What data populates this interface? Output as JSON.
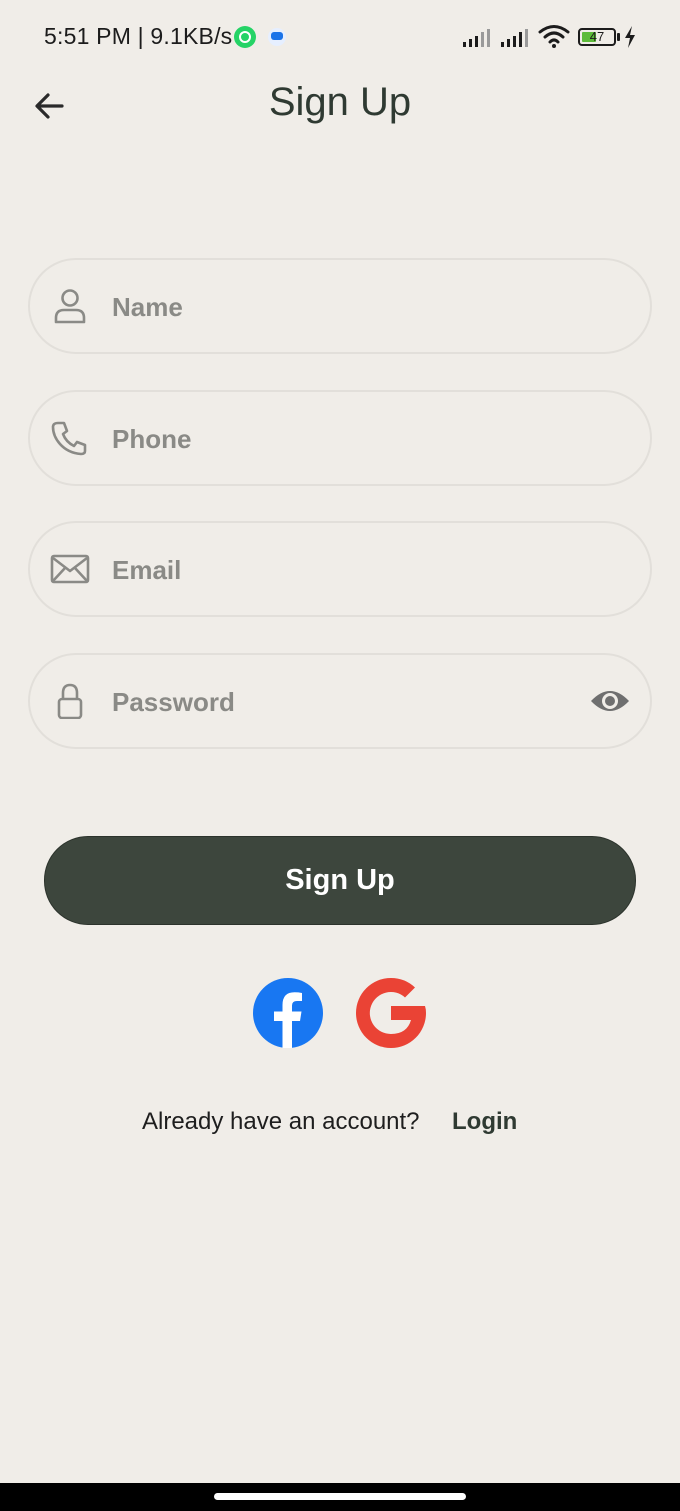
{
  "status_bar": {
    "time_speed": "5:51 PM | 9.1KB/s",
    "battery_level": "47",
    "battery_fraction": 0.47
  },
  "header": {
    "title": "Sign Up"
  },
  "form": {
    "name_placeholder": "Name",
    "phone_placeholder": "Phone",
    "email_placeholder": "Email",
    "password_placeholder": "Password"
  },
  "actions": {
    "signup_label": "Sign Up"
  },
  "footer": {
    "prompt": "Already have an account?",
    "login_label": "Login"
  },
  "colors": {
    "background": "#f0ede8",
    "primary": "#3d463d",
    "facebook": "#1877f2",
    "google": "#ea4335"
  },
  "icons": [
    "back-arrow-icon",
    "person-icon",
    "phone-icon",
    "mail-icon",
    "lock-icon",
    "eye-icon",
    "facebook-icon",
    "google-icon"
  ]
}
